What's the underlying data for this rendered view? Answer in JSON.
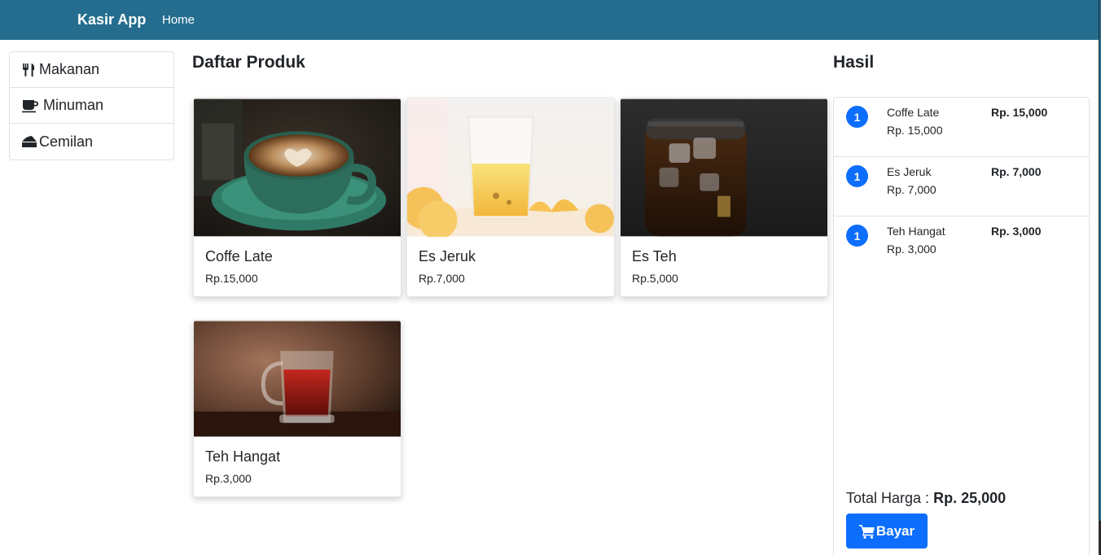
{
  "navbar": {
    "brand": "Kasir App",
    "home": "Home",
    "color": "#246d8e"
  },
  "categories": [
    {
      "label": "Makanan",
      "icon": "utensils-icon"
    },
    {
      "label": "Minuman",
      "icon": "coffee-icon"
    },
    {
      "label": "Cemilan",
      "icon": "cheese-icon"
    }
  ],
  "products_title": "Daftar Produk",
  "products": [
    {
      "name": "Coffe Late",
      "price": "Rp.15,000",
      "image": "latte-photo"
    },
    {
      "name": "Es Jeruk",
      "price": "Rp.7,000",
      "image": "orange-juice-photo"
    },
    {
      "name": "Es Teh",
      "price": "Rp.5,000",
      "image": "iced-tea-photo"
    },
    {
      "name": "Teh Hangat",
      "price": "Rp.3,000",
      "image": "hot-tea-photo"
    }
  ],
  "result": {
    "title": "Hasil",
    "items": [
      {
        "qty": "1",
        "name": "Coffe Late",
        "unit_price": "Rp. 15,000",
        "total": "Rp. 15,000"
      },
      {
        "qty": "1",
        "name": "Es Jeruk",
        "unit_price": "Rp. 7,000",
        "total": "Rp. 7,000"
      },
      {
        "qty": "1",
        "name": "Teh Hangat",
        "unit_price": "Rp. 3,000",
        "total": "Rp. 3,000"
      }
    ],
    "total_label": "Total Harga :",
    "total_value": "Rp. 25,000",
    "pay_button": "Bayar",
    "accent": "#0d6efd"
  }
}
